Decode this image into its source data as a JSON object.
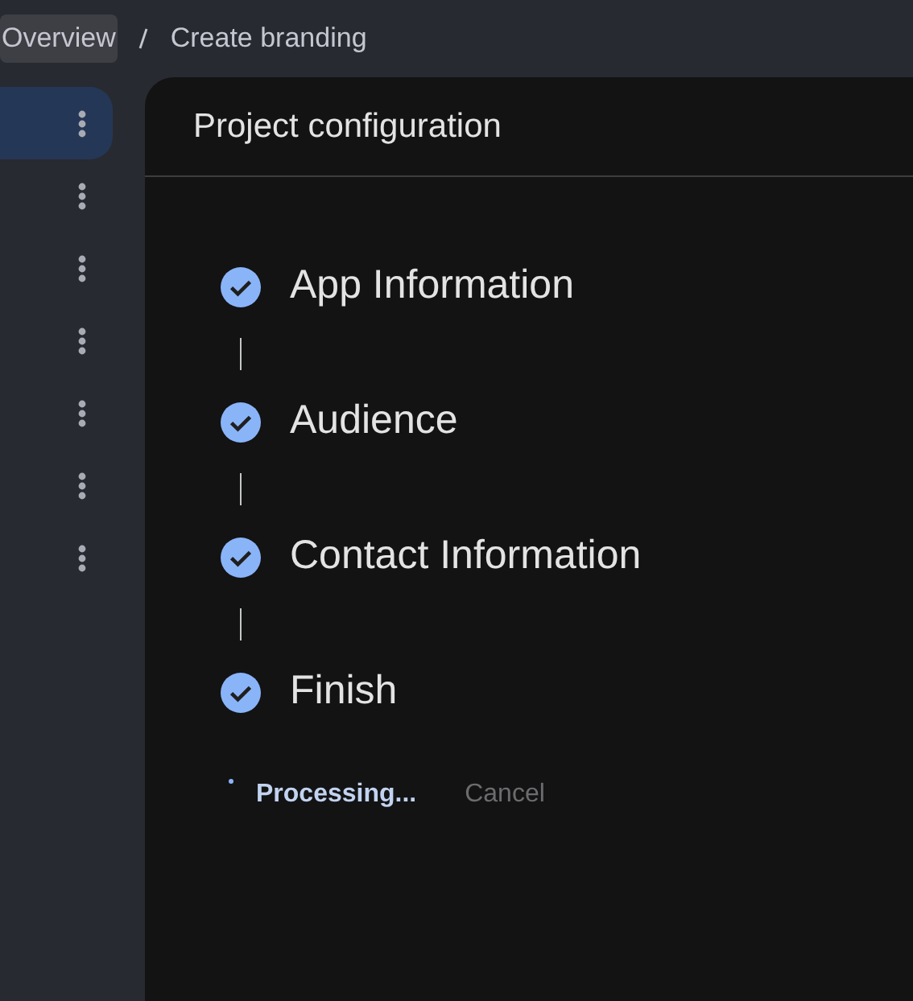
{
  "breadcrumb": [
    {
      "label": "Overview",
      "selected": true
    },
    {
      "label": "Create branding",
      "selected": false
    }
  ],
  "sidebar": {
    "items": [
      {
        "selected": true
      },
      {
        "selected": false
      },
      {
        "selected": false
      },
      {
        "selected": false
      },
      {
        "selected": false
      },
      {
        "selected": false
      },
      {
        "selected": false
      }
    ]
  },
  "panel": {
    "title": "Project configuration",
    "steps": [
      {
        "label": "App Information",
        "completed": true
      },
      {
        "label": "Audience",
        "completed": true
      },
      {
        "label": "Contact Information",
        "completed": true
      },
      {
        "label": "Finish",
        "completed": true
      }
    ],
    "actions": [
      {
        "label": "Processing...",
        "kind": "progress"
      },
      {
        "label": "Cancel",
        "kind": "cancel",
        "disabled": true
      }
    ]
  }
}
